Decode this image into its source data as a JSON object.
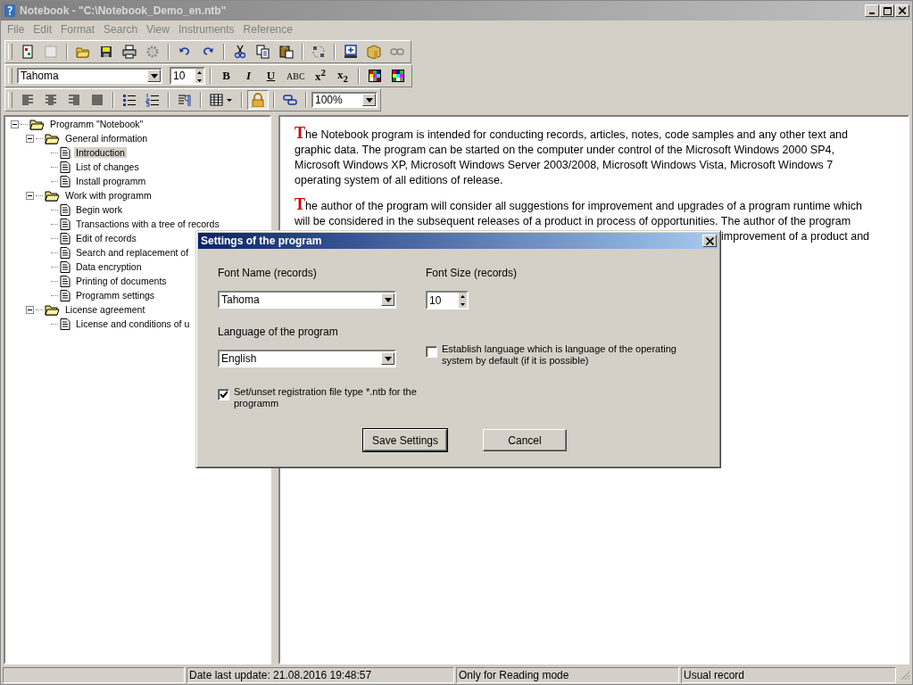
{
  "window": {
    "title": "Notebook - \"C:\\Notebook_Demo_en.ntb\"",
    "active": false
  },
  "menu": [
    {
      "label": "File",
      "disabled": true
    },
    {
      "label": "Edit",
      "disabled": true
    },
    {
      "label": "Format",
      "disabled": true
    },
    {
      "label": "Search",
      "disabled": true
    },
    {
      "label": "View",
      "disabled": true
    },
    {
      "label": "Instruments",
      "disabled": true
    },
    {
      "label": "Reference",
      "disabled": true
    }
  ],
  "format_bar": {
    "font": "Tahoma",
    "size": "10",
    "styles": [
      {
        "label": "B",
        "kind": "bold"
      },
      {
        "label": "I",
        "kind": "italic"
      },
      {
        "label": "U",
        "kind": "underline"
      },
      {
        "label": "ABC",
        "kind": "strike"
      },
      {
        "label": "x$^{2}$",
        "kind": "super"
      },
      {
        "label": "x$_{2}$",
        "kind": "sub"
      }
    ]
  },
  "paragraph_bar": {
    "zoom": "100%",
    "lock_on": true
  },
  "tree": [
    {
      "label": "Programm \"Notebook\"",
      "expanded": true,
      "selected": false,
      "children": [
        {
          "label": "General information",
          "expanded": true,
          "selected": false,
          "children": [
            {
              "label": "Introduction",
              "selected": true
            },
            {
              "label": "List of changes",
              "selected": false
            },
            {
              "label": "Install programm",
              "selected": false
            }
          ]
        },
        {
          "label": "Work with programm",
          "expanded": true,
          "selected": false,
          "children": [
            {
              "label": "Begin work",
              "selected": false
            },
            {
              "label": "Transactions with a tree of records",
              "selected": false
            },
            {
              "label": "Edit of records",
              "selected": false
            },
            {
              "label": "Search and replacement of",
              "selected": false
            },
            {
              "label": "Data encryption",
              "selected": false
            },
            {
              "label": "Printing of documents",
              "selected": false
            },
            {
              "label": "Programm settings",
              "selected": false
            }
          ]
        },
        {
          "label": "License agreement",
          "expanded": true,
          "selected": false,
          "children": [
            {
              "label": "License and conditions of u",
              "selected": false
            }
          ]
        }
      ]
    }
  ],
  "document": {
    "paragraphs": [
      {
        "initial": "T",
        "lines": [
          "he Notebook program is intended for conducting records, articles, notes, code samples and any other text and",
          "graphic data. The program can be started on the computer under control of the Microsoft Windows 2000 SP4,",
          "Microsoft Windows XP, Microsoft Windows Server 2003/2008, Microsoft Windows Vista, Microsoft Windows 7",
          "operating system of all editions of release."
        ]
      },
      {
        "initial": "T",
        "lines": [
          "he author of the program will consider all suggestions for improvement and upgrades of a program runtime which",
          "will be considered in the subsequent releases of a product in process of opportunities. The author of the program"
        ],
        "fragment": "improvement of a product and"
      }
    ]
  },
  "dialog": {
    "title": "Settings of the program",
    "font_label": "Font Name (records)",
    "font_value": "Tahoma",
    "size_label": "Font Size (records)",
    "size_value": "10",
    "language_label": "Language of the program",
    "language_value": "English",
    "checkboxes": [
      {
        "label": "Establish language which is language of the operating system by default (if it is possible)",
        "checked": false
      },
      {
        "label": "Set/unset registration file type *.ntb for the programm",
        "checked": true
      }
    ],
    "buttons": [
      {
        "label": "Save Settings",
        "default": true
      },
      {
        "label": "Cancel",
        "default": false
      }
    ]
  },
  "status_bar": [
    {
      "text": "Date last update: 21.08.2016 19:48:57"
    },
    {
      "text": "Only for Reading mode"
    },
    {
      "text": "Usual record"
    }
  ]
}
